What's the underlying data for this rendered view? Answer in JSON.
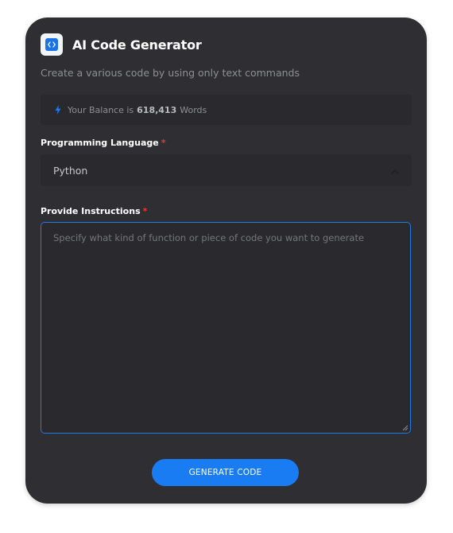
{
  "header": {
    "title": "AI Code Generator",
    "subtitle": "Create a various code by using only text commands"
  },
  "balance": {
    "prefix": "Your Balance is",
    "amount": "618,413",
    "suffix": "Words"
  },
  "language": {
    "label": "Programming Language",
    "required_mark": "*",
    "selected": "Python"
  },
  "instructions": {
    "label": "Provide Instructions",
    "required_mark": "*",
    "placeholder": "Specify what kind of function or piece of code you want to generate",
    "value": ""
  },
  "generate_button": {
    "label": "GENERATE CODE"
  },
  "colors": {
    "card_bg": "#2f2f33",
    "field_bg": "#2a2a2e",
    "accent": "#1a7cf2",
    "required": "#e53935"
  },
  "icons": {
    "app": "code-brackets-icon",
    "balance": "lightning-bolt-icon",
    "select": "chevron-up-icon"
  }
}
